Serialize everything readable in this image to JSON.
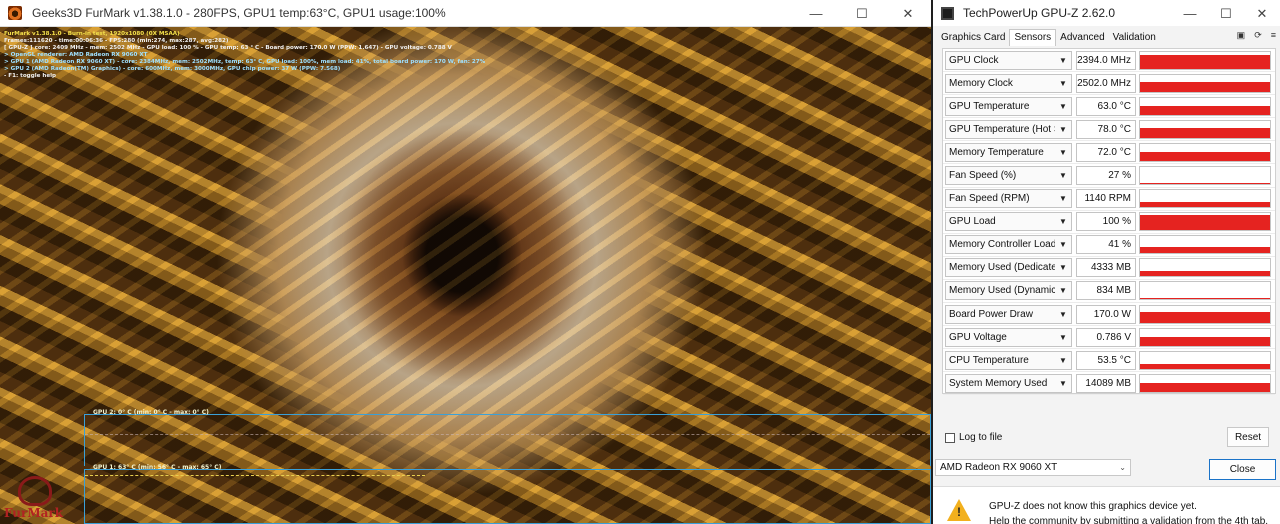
{
  "furmark": {
    "title": "Geeks3D FurMark v1.38.1.0 - 280FPS, GPU1 temp:63°C, GPU1 usage:100%",
    "hud": [
      {
        "text": "FurMark v1.38.1.0 - Burn-in test, 1920x1080 (0X MSAA)",
        "color": "yellow"
      },
      {
        "text": "Frames:111620 - time:00:06:36 - FPS:280 (min:274, max:287, avg:282)",
        "color": "white"
      },
      {
        "text": "[ GPU-Z ] core: 2409 MHz - mem: 2502 MHz - GPU load: 100 % - GPU temp: 63 ° C - Board power: 170.0 W (PPW: 1.647) - GPU voltage: 0.788 V",
        "color": "white"
      },
      {
        "text": "> OpenGL renderer: AMD Radeon RX 9060 XT",
        "color": "cyan"
      },
      {
        "text": "> GPU 1 (AMD Radeon RX 9060 XT) - core: 2384MHz, mem: 2502MHz, temp: 63° C, GPU load: 100%, mem load: 41%, total board power: 170 W, fan: 27%",
        "color": "cyan"
      },
      {
        "text": "> GPU 2 (AMD Radeon(TM) Graphics) - core: 600MHz, mem: 3000MHz, GPU chip power: 37 W (PPW: 7.568)",
        "color": "cyan"
      },
      {
        "text": "- F1: toggle help",
        "color": "white"
      }
    ],
    "graph_gpu2_label": "GPU 2: 0° C (min: 0° C - max: 0° C)",
    "graph_gpu1_label": "GPU 1: 63° C (min: 56° C - max: 65° C)",
    "brand": "FurMark"
  },
  "gpuz": {
    "title": "TechPowerUp GPU-Z 2.62.0",
    "tabs": [
      "Graphics Card",
      "Sensors",
      "Advanced",
      "Validation"
    ],
    "active_tab": "Sensors",
    "sensors": [
      {
        "name": "GPU Clock",
        "value": "2394.0 MHz",
        "level": 0.82
      },
      {
        "name": "Memory Clock",
        "value": "2502.0 MHz",
        "level": 0.55
      },
      {
        "name": "GPU Temperature",
        "value": "63.0 °C",
        "level": 0.5
      },
      {
        "name": "GPU Temperature (Hot Spot)",
        "value": "78.0 °C",
        "level": 0.55
      },
      {
        "name": "Memory Temperature",
        "value": "72.0 °C",
        "level": 0.5
      },
      {
        "name": "Fan Speed (%)",
        "value": "27 %",
        "level": 0.08
      },
      {
        "name": "Fan Speed (RPM)",
        "value": "1140 RPM",
        "level": 0.3
      },
      {
        "name": "GPU Load",
        "value": "100 %",
        "level": 0.9
      },
      {
        "name": "Memory Controller Load",
        "value": "41 %",
        "level": 0.35
      },
      {
        "name": "Memory Used (Dedicated)",
        "value": "4333 MB",
        "level": 0.3
      },
      {
        "name": "Memory Used (Dynamic)",
        "value": "834 MB",
        "level": 0.08
      },
      {
        "name": "Board Power Draw",
        "value": "170.0 W",
        "level": 0.6
      },
      {
        "name": "GPU Voltage",
        "value": "0.786 V",
        "level": 0.5
      },
      {
        "name": "CPU Temperature",
        "value": "53.5 °C",
        "level": 0.3
      },
      {
        "name": "System Memory Used",
        "value": "14089 MB",
        "level": 0.55
      }
    ],
    "log_label": "Log to file",
    "reset_label": "Reset",
    "device": "AMD Radeon RX 9060 XT",
    "close_label": "Close",
    "notice_line1": "GPU-Z does not know this graphics device yet.",
    "notice_line2": "Help the community by submitting a validation from the 4th tab."
  },
  "colors": {
    "graph_fill": "#e52320",
    "hud_yellow": "#f4e04a",
    "hud_cyan": "#9fe0ff"
  }
}
